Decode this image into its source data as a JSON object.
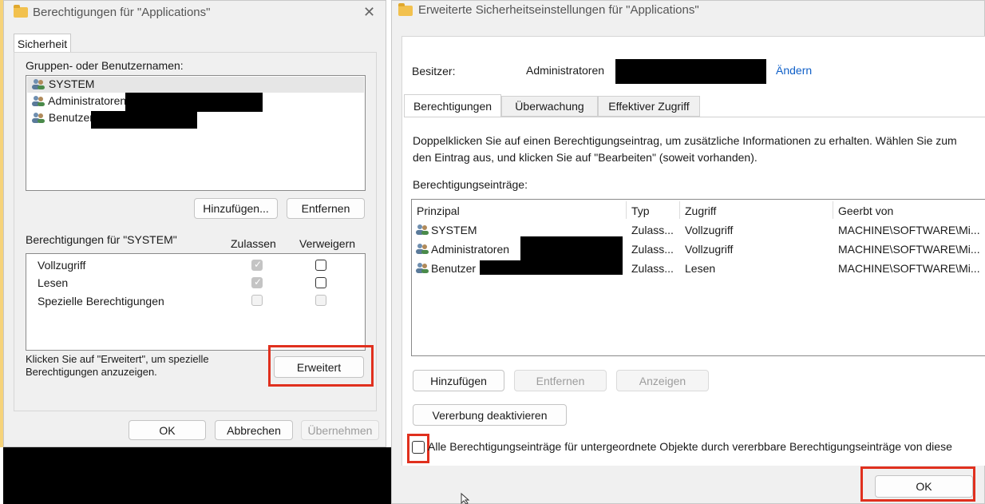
{
  "left_window": {
    "title": "Berechtigungen für \"Applications\"",
    "close_glyph": "✕",
    "tab": "Sicherheit",
    "group_label": "Gruppen- oder Benutzernamen:",
    "users": [
      {
        "name": "SYSTEM"
      },
      {
        "name": "Administratoren"
      },
      {
        "name": "Benutzer"
      }
    ],
    "add_button": "Hinzufügen...",
    "remove_button": "Entfernen",
    "perm_label": "Berechtigungen für \"SYSTEM\"",
    "allow_header": "Zulassen",
    "deny_header": "Verweigern",
    "permissions": [
      {
        "name": "Vollzugriff",
        "allow": true,
        "deny": false
      },
      {
        "name": "Lesen",
        "allow": true,
        "deny": false
      },
      {
        "name": "Spezielle Berechtigungen",
        "allow": false,
        "deny": false
      }
    ],
    "advanced_hint_1": "Klicken Sie auf \"Erweitert\", um spezielle",
    "advanced_hint_2": "Berechtigungen anzuzeigen.",
    "advanced_button": "Erweitert",
    "ok_button": "OK",
    "cancel_button": "Abbrechen",
    "apply_button": "Übernehmen"
  },
  "right_window": {
    "title": "Erweiterte Sicherheitseinstellungen für \"Applications\"",
    "owner_label": "Besitzer:",
    "owner_value": "Administratoren",
    "change_link": "Ändern",
    "tabs": [
      "Berechtigungen",
      "Überwachung",
      "Effektiver Zugriff"
    ],
    "info_line_1": "Doppelklicken Sie auf einen Berechtigungseintrag, um zusätzliche Informationen zu erhalten. Wählen Sie zum",
    "info_line_2": "den Eintrag aus, und klicken Sie auf \"Bearbeiten\" (soweit vorhanden).",
    "entries_label": "Berechtigungseinträge:",
    "columns": [
      "Prinzipal",
      "Typ",
      "Zugriff",
      "Geerbt von"
    ],
    "rows": [
      {
        "principal": "SYSTEM",
        "type": "Zulass...",
        "access": "Vollzugriff",
        "inherited": "MACHINE\\SOFTWARE\\Mi..."
      },
      {
        "principal": "Administratoren",
        "type": "Zulass...",
        "access": "Vollzugriff",
        "inherited": "MACHINE\\SOFTWARE\\Mi..."
      },
      {
        "principal": "Benutzer",
        "type": "Zulass...",
        "access": "Lesen",
        "inherited": "MACHINE\\SOFTWARE\\Mi..."
      }
    ],
    "add_button": "Hinzufügen",
    "remove_button": "Entfernen",
    "view_button": "Anzeigen",
    "disable_inheritance_button": "Vererbung deaktivieren",
    "replace_checkbox_label": "Alle Berechtigungseinträge für untergeordnete Objekte durch vererbbare Berechtigungseinträge von diese",
    "ok_button": "OK"
  },
  "colors": {
    "highlight_red": "#e0301e",
    "link_blue": "#1060c8"
  }
}
